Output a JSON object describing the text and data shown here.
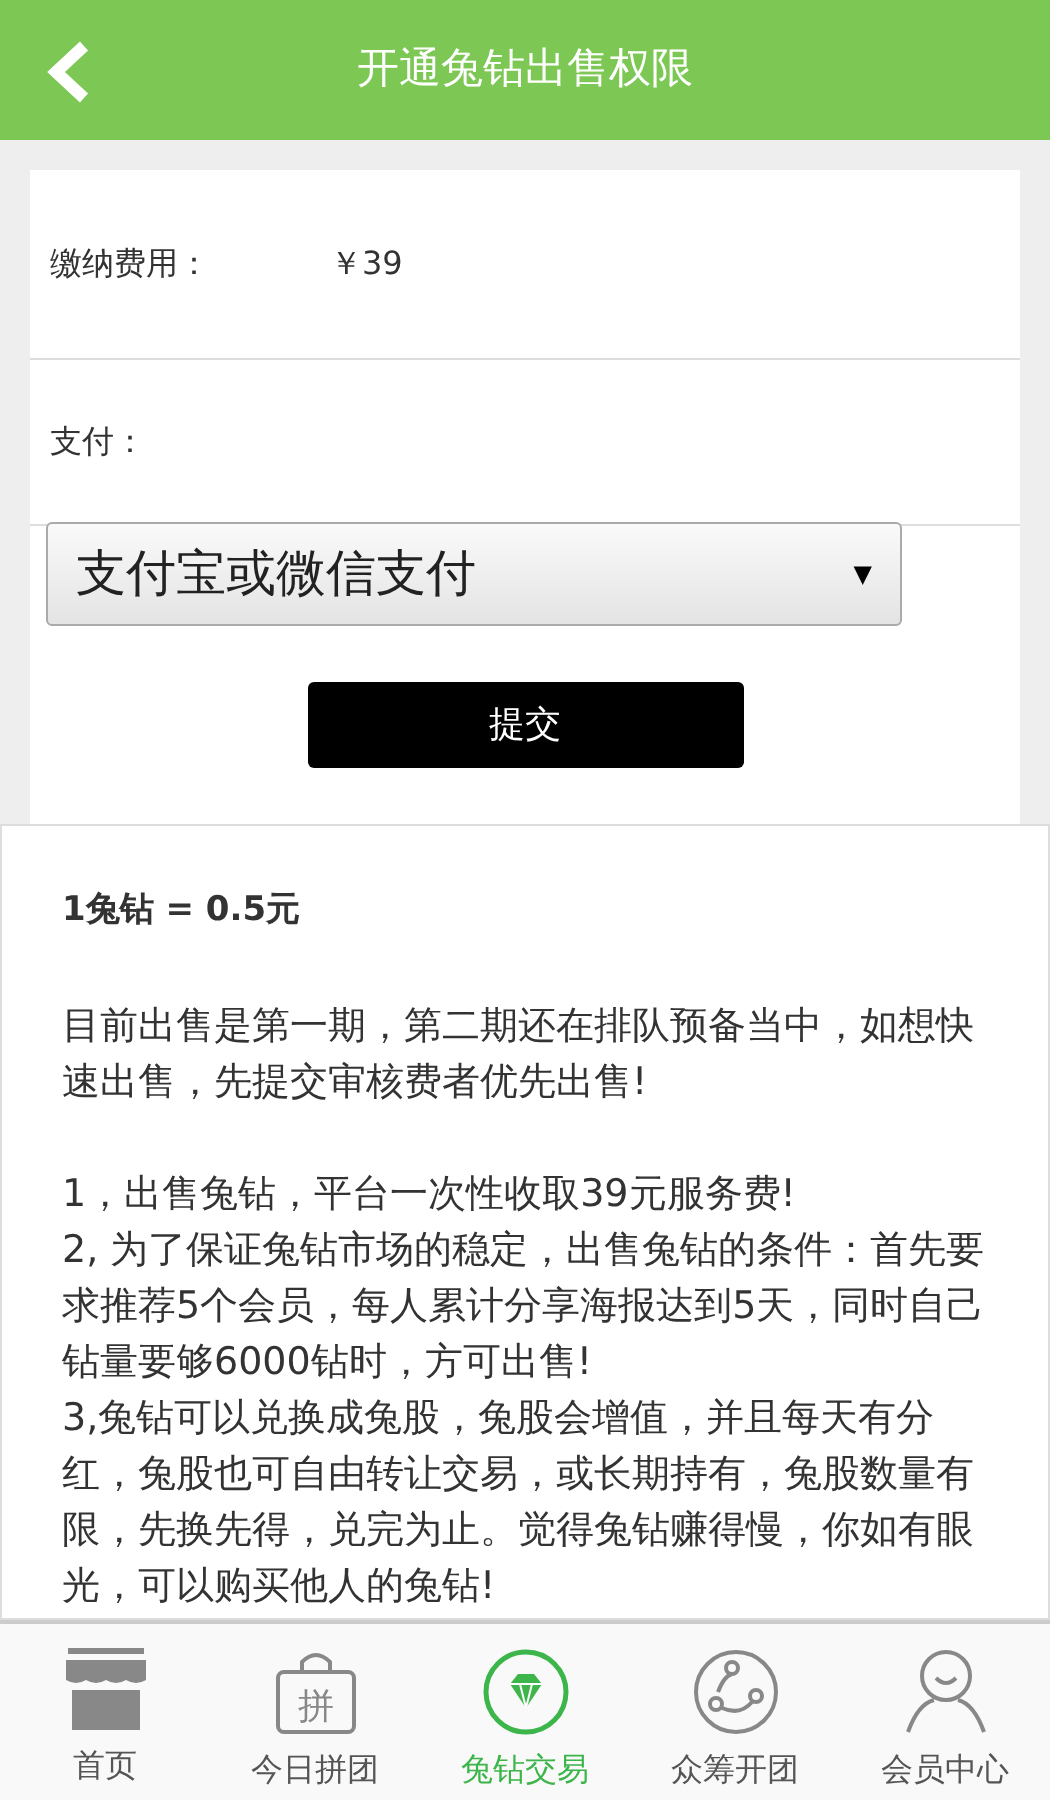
{
  "header": {
    "title": "开通兔钻出售权限"
  },
  "form": {
    "fee_label": "缴纳费用：",
    "fee_value": "￥39",
    "pay_label": "支付：",
    "pay_select": "支付宝或微信支付",
    "select_caret": "▼",
    "submit": "提交"
  },
  "info": {
    "rate": "1兔钻 = 0.5元",
    "paragraphs": [
      "目前出售是第一期，第二期还在排队预备当中，如想快速出售，先提交审核费者优先出售!",
      "1，出售兔钻，平台一次性收取39元服务费!\n2, 为了保证兔钻市场的稳定，出售兔钻的条件：首先要求推荐5个会员，每人累计分享海报达到5天，同时自己钻量要够6000钻时，方可出售!\n3,兔钻可以兑换成兔股，兔股会增值，并且每天有分红，兔股也可自由转让交易，或长期持有，兔股数量有限，先换先得，兑完为止。觉得兔钻赚得慢，你如有眼光，可以购买他人的兔钻!"
    ]
  },
  "tabs": [
    {
      "kind": "shop",
      "label": "首页",
      "selected": false
    },
    {
      "kind": "bag",
      "label": "今日拼团",
      "icon_text": "拼",
      "selected": false
    },
    {
      "kind": "gem",
      "label": "兔钻交易",
      "selected": true
    },
    {
      "kind": "share",
      "label": "众筹开团",
      "selected": false
    },
    {
      "kind": "user",
      "label": "会员中心",
      "selected": false
    }
  ]
}
